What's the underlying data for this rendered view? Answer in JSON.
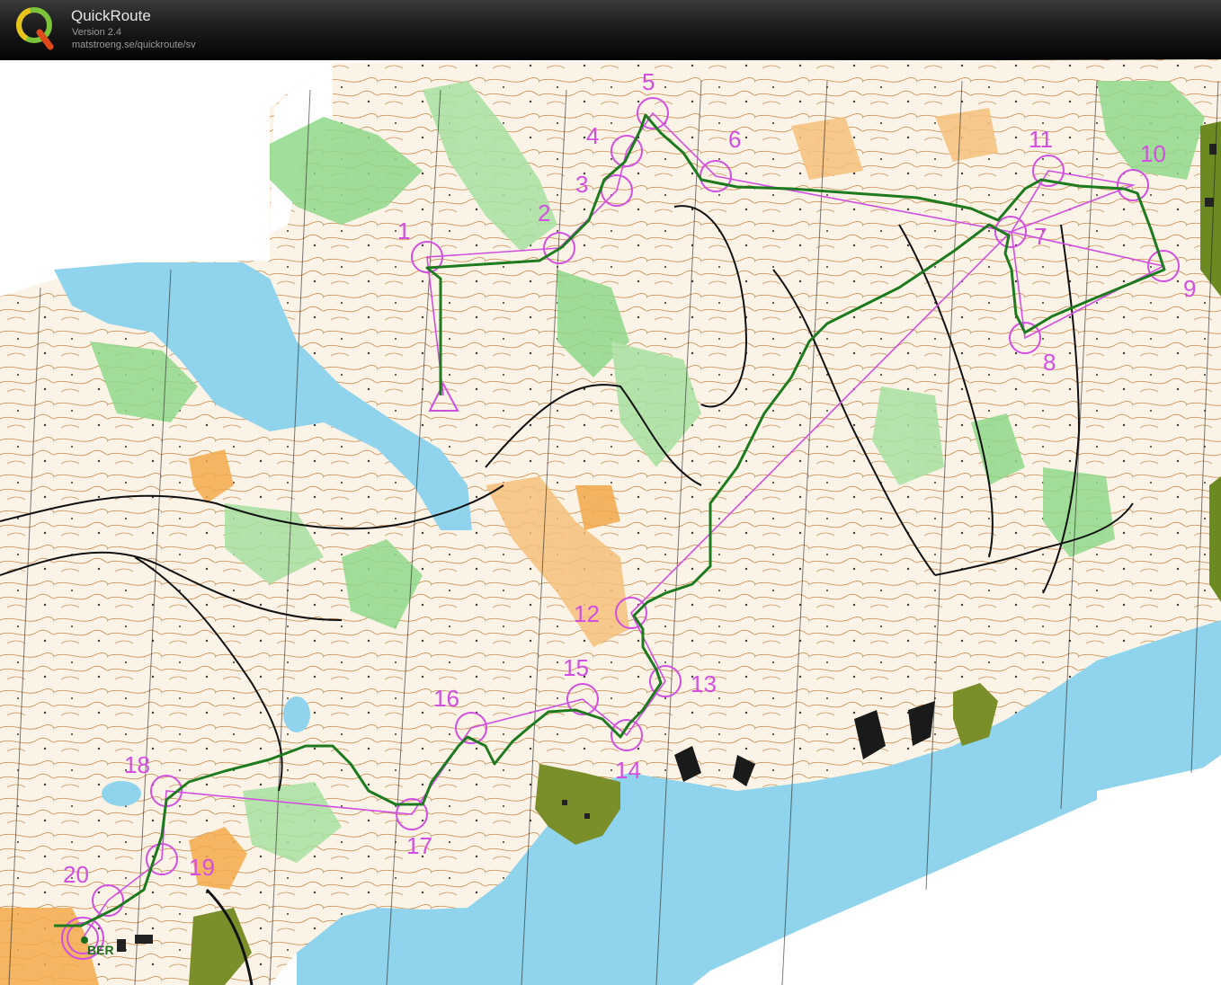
{
  "app": {
    "name": "QuickRoute",
    "version": "Version 2.4",
    "url": "matstroeng.se/quickroute/sv"
  },
  "map": {
    "start_label": "BER",
    "controls": [
      {
        "number": "1"
      },
      {
        "number": "2"
      },
      {
        "number": "3"
      },
      {
        "number": "4"
      },
      {
        "number": "5"
      },
      {
        "number": "6"
      },
      {
        "number": "7"
      },
      {
        "number": "8"
      },
      {
        "number": "9"
      },
      {
        "number": "10"
      },
      {
        "number": "11"
      },
      {
        "number": "12"
      },
      {
        "number": "13"
      },
      {
        "number": "14"
      },
      {
        "number": "15"
      },
      {
        "number": "16"
      },
      {
        "number": "17"
      },
      {
        "number": "18"
      },
      {
        "number": "19"
      },
      {
        "number": "20"
      }
    ],
    "colors": {
      "course": "#d24fe0",
      "route": "#1e7a1e",
      "water": "#8fd3ec",
      "terrain": "#fbf4e8",
      "forest": "#8fd88a",
      "open_land": "#f6c07a",
      "contour": "#b86a2a",
      "settlement": "#6e8f2a"
    }
  }
}
